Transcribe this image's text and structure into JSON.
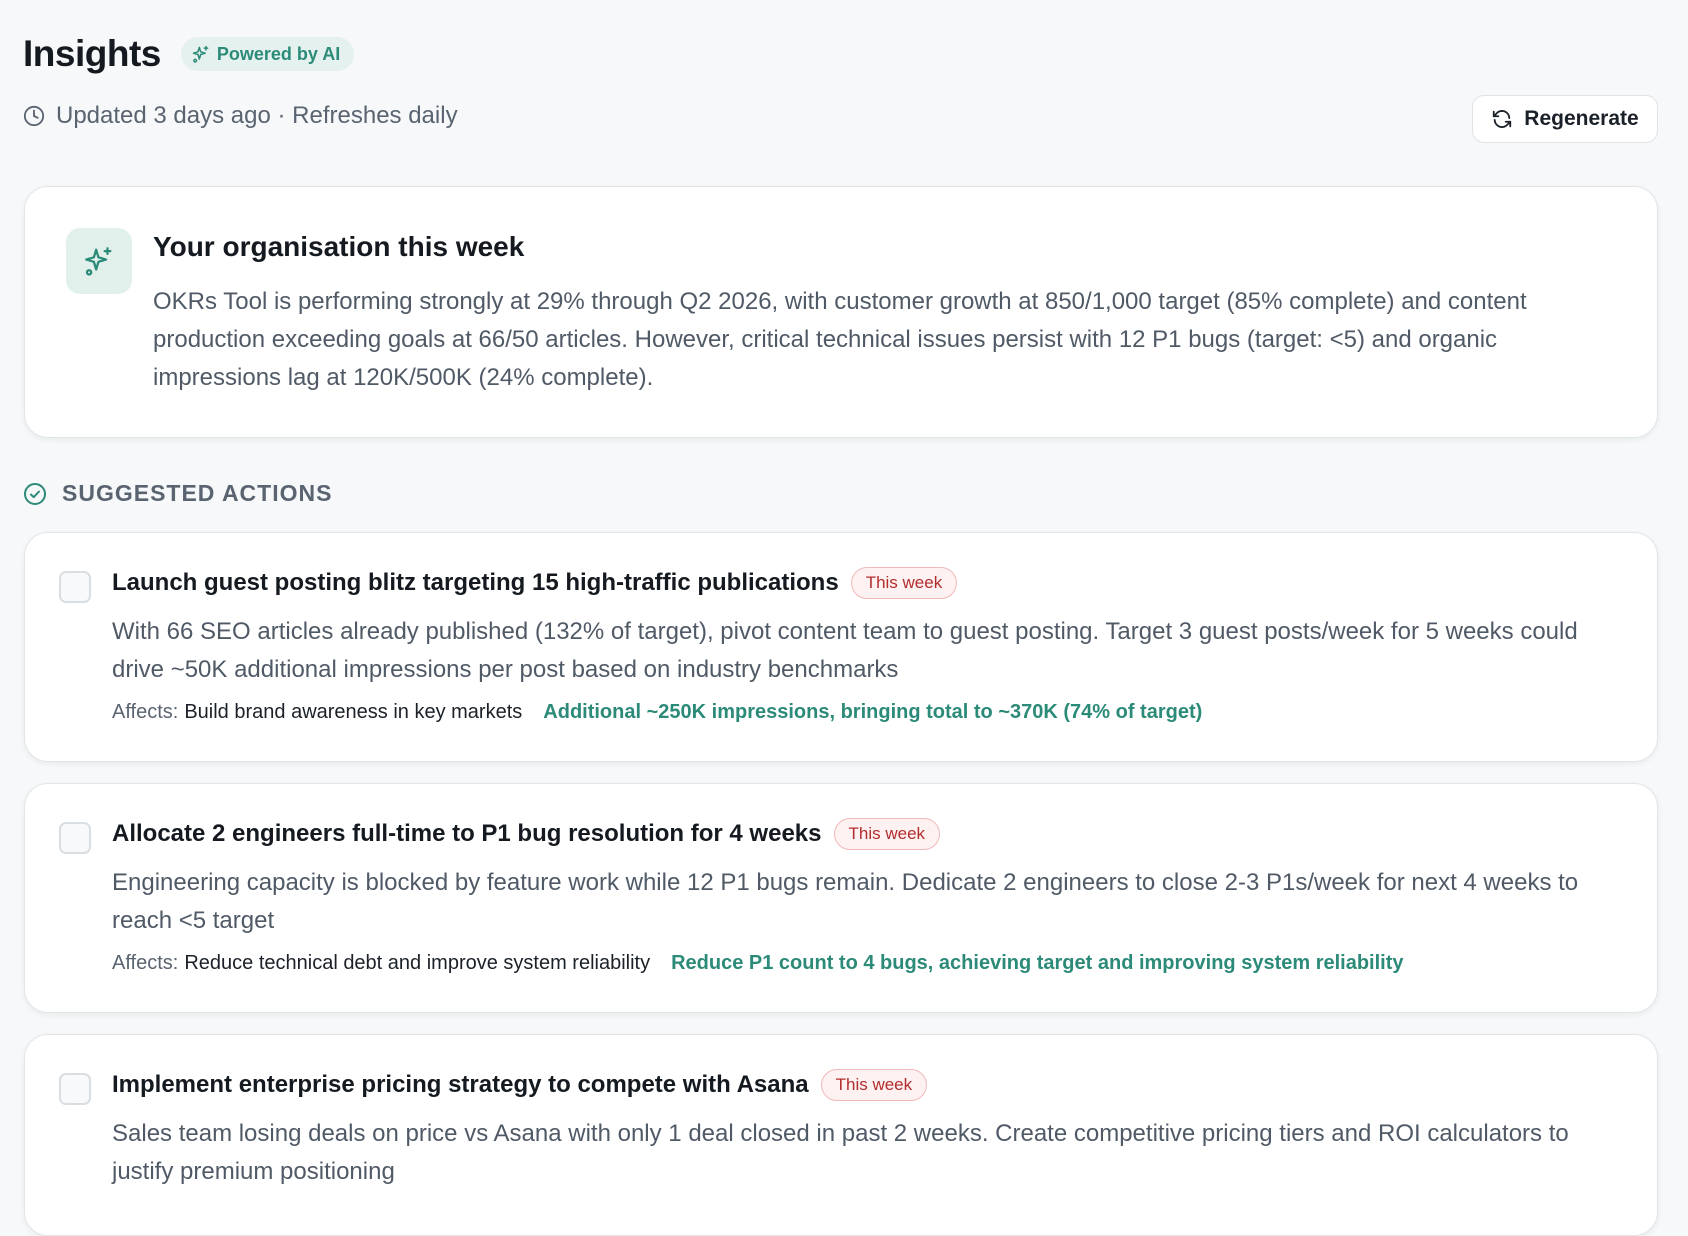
{
  "header": {
    "title": "Insights",
    "ai_badge": "Powered by AI",
    "updated": "Updated 3 days ago · Refreshes daily",
    "regenerate_label": "Regenerate"
  },
  "summary": {
    "title": "Your organisation this week",
    "body": "OKRs Tool is performing strongly at 29% through Q2 2026, with customer growth at 850/1,000 target (85% complete) and content production exceeding goals at 66/50 articles. However, critical technical issues persist with 12 P1 bugs (target: <5) and organic impressions lag at 120K/500K (24% complete)."
  },
  "suggested": {
    "label": "SUGGESTED ACTIONS",
    "items": [
      {
        "title": "Launch guest posting blitz targeting 15 high-traffic publications",
        "badge": "This week",
        "description": "With 66 SEO articles already published (132% of target), pivot content team to guest posting. Target 3 guest posts/week for 5 weeks could drive ~50K additional impressions per post based on industry benchmarks",
        "affects_label": "Affects:",
        "affects": "Build brand awareness in key markets",
        "impact": "Additional ~250K impressions, bringing total to ~370K (74% of target)"
      },
      {
        "title": "Allocate 2 engineers full-time to P1 bug resolution for 4 weeks",
        "badge": "This week",
        "description": "Engineering capacity is blocked by feature work while 12 P1 bugs remain. Dedicate 2 engineers to close 2-3 P1s/week for next 4 weeks to reach <5 target",
        "affects_label": "Affects:",
        "affects": "Reduce technical debt and improve system reliability",
        "impact": "Reduce P1 count to 4 bugs, achieving target and improving system reliability"
      },
      {
        "title": "Implement enterprise pricing strategy to compete with Asana",
        "badge": "This week",
        "description": "Sales team losing deals on price vs Asana with only 1 deal closed in past 2 weeks. Create competitive pricing tiers and ROI calculators to justify premium positioning"
      }
    ]
  },
  "colors": {
    "accent": "#2c8a78",
    "badge_red": "#b42d2d",
    "background": "#f6f8f9"
  },
  "icons": {
    "ai_badge": "sparkles-icon",
    "updated": "clock-icon",
    "regenerate": "refresh-icon",
    "summary": "sparkles-icon",
    "section": "check-circle-icon"
  }
}
